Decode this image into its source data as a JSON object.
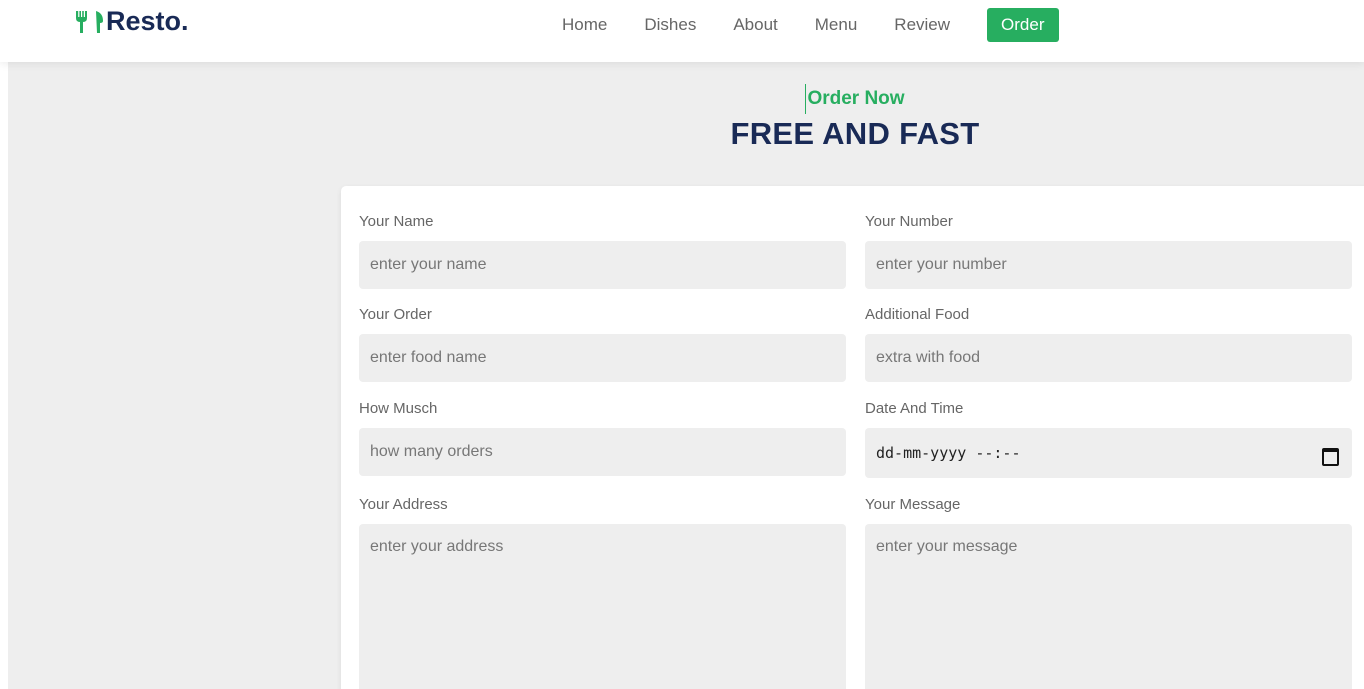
{
  "header": {
    "logo_text": "Resto.",
    "logo_icon": "utensils-icon",
    "nav": [
      "Home",
      "Dishes",
      "About",
      "Menu",
      "Review",
      "Order"
    ],
    "active_nav": "Order",
    "accent_color": "#27ae60",
    "brand_color": "#192a56"
  },
  "order_section": {
    "subheading": "Order Now",
    "heading": "FREE AND FAST"
  },
  "form": {
    "name": {
      "label": "Your Name",
      "placeholder": "enter your name"
    },
    "number": {
      "label": "Your Number",
      "placeholder": "enter your number"
    },
    "order": {
      "label": "Your Order",
      "placeholder": "enter food name"
    },
    "additional": {
      "label": "Additional Food",
      "placeholder": "extra with food"
    },
    "quantity": {
      "label": "How Musch",
      "placeholder": "how many orders"
    },
    "datetime": {
      "label": "Date And Time",
      "value": "dd-mm-yyyy --:--",
      "icon": "calendar-icon"
    },
    "address": {
      "label": "Your Address",
      "placeholder": "enter your address"
    },
    "message": {
      "label": "Your Message",
      "placeholder": "enter your message"
    }
  }
}
